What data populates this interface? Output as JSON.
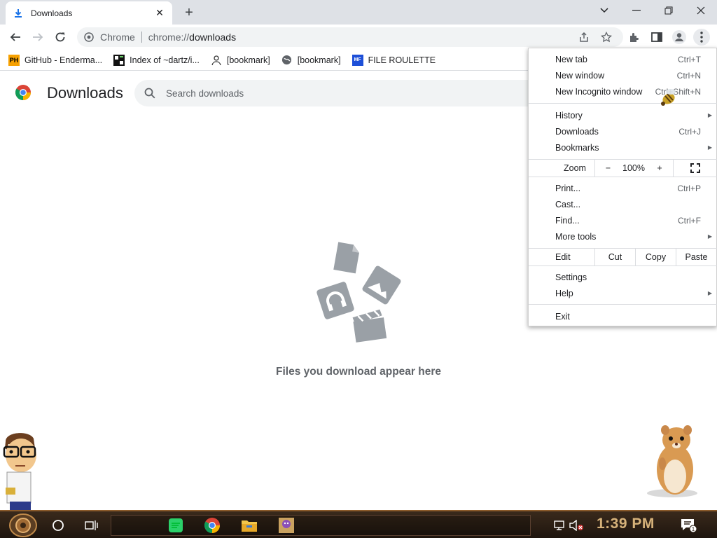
{
  "tab": {
    "title": "Downloads",
    "icon": "download-icon"
  },
  "window_controls": [
    "tab-search-icon",
    "minimize-icon",
    "restore-icon",
    "close-icon"
  ],
  "omnibox": {
    "site_label": "Chrome",
    "url_scheme": "chrome://",
    "url_host": "downloads"
  },
  "bookmarks": [
    {
      "label": "GitHub - Enderma...",
      "icon": "ph",
      "icon_text": "PH"
    },
    {
      "label": "Index of ~dartz/i...",
      "icon": "grid",
      "icon_text": ""
    },
    {
      "label": "[bookmark]",
      "icon": "person",
      "icon_text": ""
    },
    {
      "label": "[bookmark]",
      "icon": "globe",
      "icon_text": ""
    },
    {
      "label": "FILE ROULETTE",
      "icon": "mf",
      "icon_text": "MF"
    }
  ],
  "page": {
    "title": "Downloads",
    "search_placeholder": "Search downloads",
    "empty_message": "Files you download appear here"
  },
  "menu": {
    "new_tab": {
      "label": "New tab",
      "shortcut": "Ctrl+T"
    },
    "new_window": {
      "label": "New window",
      "shortcut": "Ctrl+N"
    },
    "new_incognito": {
      "label": "New Incognito window",
      "shortcut": "Ctrl+Shift+N"
    },
    "history": {
      "label": "History"
    },
    "downloads": {
      "label": "Downloads",
      "shortcut": "Ctrl+J"
    },
    "bookmarks": {
      "label": "Bookmarks"
    },
    "zoom": {
      "label": "Zoom",
      "minus": "−",
      "value": "100%",
      "plus": "+"
    },
    "print": {
      "label": "Print...",
      "shortcut": "Ctrl+P"
    },
    "cast": {
      "label": "Cast..."
    },
    "find": {
      "label": "Find...",
      "shortcut": "Ctrl+F"
    },
    "more_tools": {
      "label": "More tools"
    },
    "edit": {
      "label": "Edit",
      "cut": "Cut",
      "copy": "Copy",
      "paste": "Paste"
    },
    "settings": {
      "label": "Settings"
    },
    "help": {
      "label": "Help"
    },
    "exit": {
      "label": "Exit"
    }
  },
  "taskbar": {
    "clock": "1:39 PM",
    "notification_count": "1",
    "apps": [
      "cortana-icon",
      "task-view-icon",
      "spotify-icon",
      "chrome-icon",
      "file-explorer-icon",
      "bonzi-icon"
    ]
  },
  "colors": {
    "accent": "#1a73e8",
    "menu_bg": "#ffffff",
    "tab_strip": "#dee1e6",
    "taskbar": "#2a1d12",
    "clock": "#d6b27a"
  }
}
